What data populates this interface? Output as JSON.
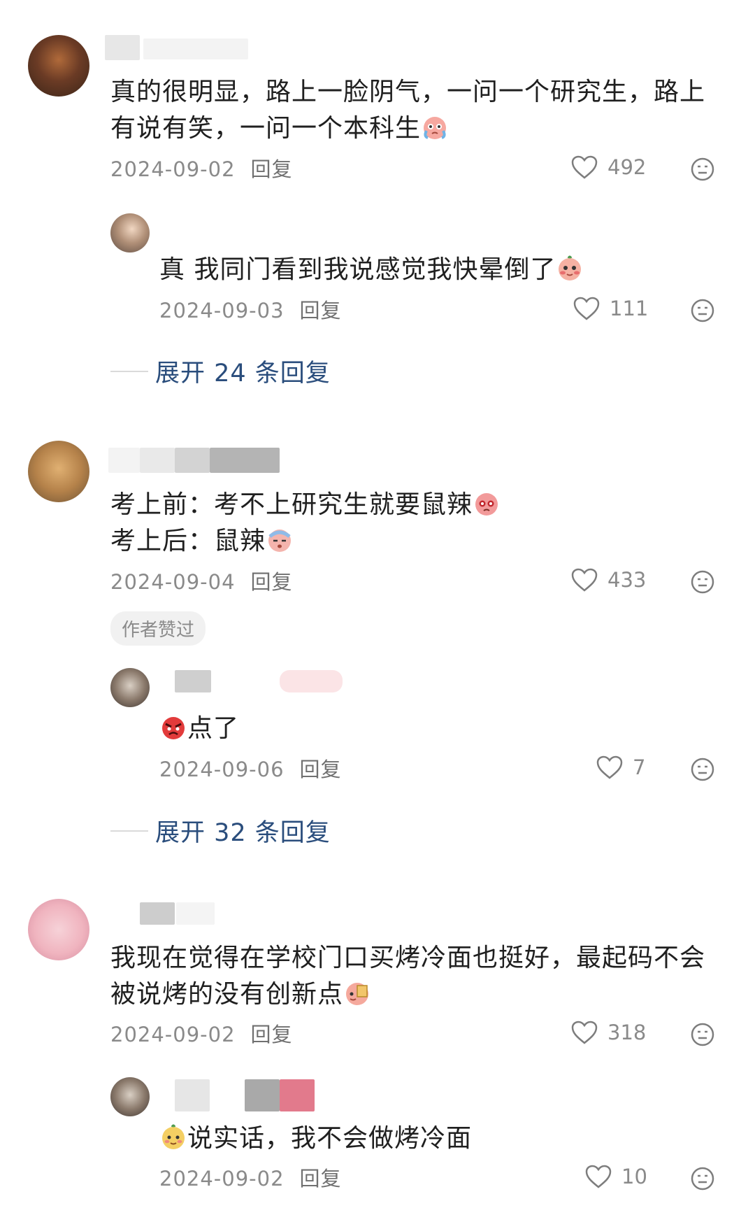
{
  "comments": [
    {
      "text": "真的很明显，路上一脸阴气，一问一个研究生，路上有说有笑，一问一个本科生",
      "date": "2024-09-02",
      "reply_label": "回复",
      "likes": "492",
      "reply": {
        "text": "真 我同门看到我说感觉我快晕倒了",
        "date": "2024-09-03",
        "reply_label": "回复",
        "likes": "111"
      },
      "expand": "展开 24 条回复"
    },
    {
      "text_line1": "考上前：考不上研究生就要鼠辣",
      "text_line2": "考上后：鼠辣",
      "date": "2024-09-04",
      "reply_label": "回复",
      "likes": "433",
      "badge": "作者赞过",
      "reply": {
        "text": "点了",
        "date": "2024-09-06",
        "reply_label": "回复",
        "likes": "7"
      },
      "expand": "展开 32 条回复"
    },
    {
      "text": "我现在觉得在学校门口买烤冷面也挺好，最起码不会被说烤的没有创新点",
      "date": "2024-09-02",
      "reply_label": "回复",
      "likes": "318",
      "reply": {
        "text": "说实话，我不会做烤冷面",
        "date": "2024-09-02",
        "reply_label": "回复",
        "likes": "10"
      }
    }
  ],
  "icons": {
    "like": "heart-outline-icon",
    "more": "face-neutral-icon",
    "emoji_cry": "crying-emoji-icon",
    "emoji_blush": "blush-emoji-icon",
    "emoji_angry": "angry-emoji-icon"
  },
  "colors": {
    "link": "#2a4d7c",
    "meta": "#8a8a8a"
  }
}
